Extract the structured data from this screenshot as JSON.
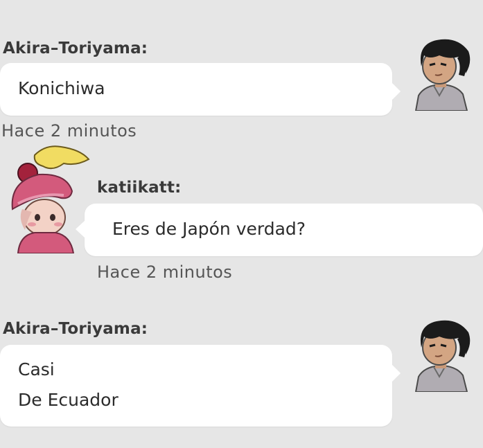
{
  "messages": [
    {
      "sender": "Akira–Toriyama:",
      "lines": [
        "Konichiwa"
      ],
      "time": "Hace 2 minutos",
      "avatar_icon": "boy-avatar-icon"
    },
    {
      "sender": "katiikatt:",
      "lines": [
        "Eres de Japón verdad?"
      ],
      "time": "Hace 2 minutos",
      "avatar_icon": "girl-avatar-icon"
    },
    {
      "sender": "Akira–Toriyama:",
      "lines": [
        "Casi",
        "De Ecuador"
      ],
      "avatar_icon": "boy-avatar-icon"
    }
  ],
  "colors": {
    "background": "#e6e6e6",
    "bubble": "#ffffff",
    "sender_text": "#3a3a3a",
    "message_text": "#2b2b2b",
    "time_text": "#555555"
  }
}
